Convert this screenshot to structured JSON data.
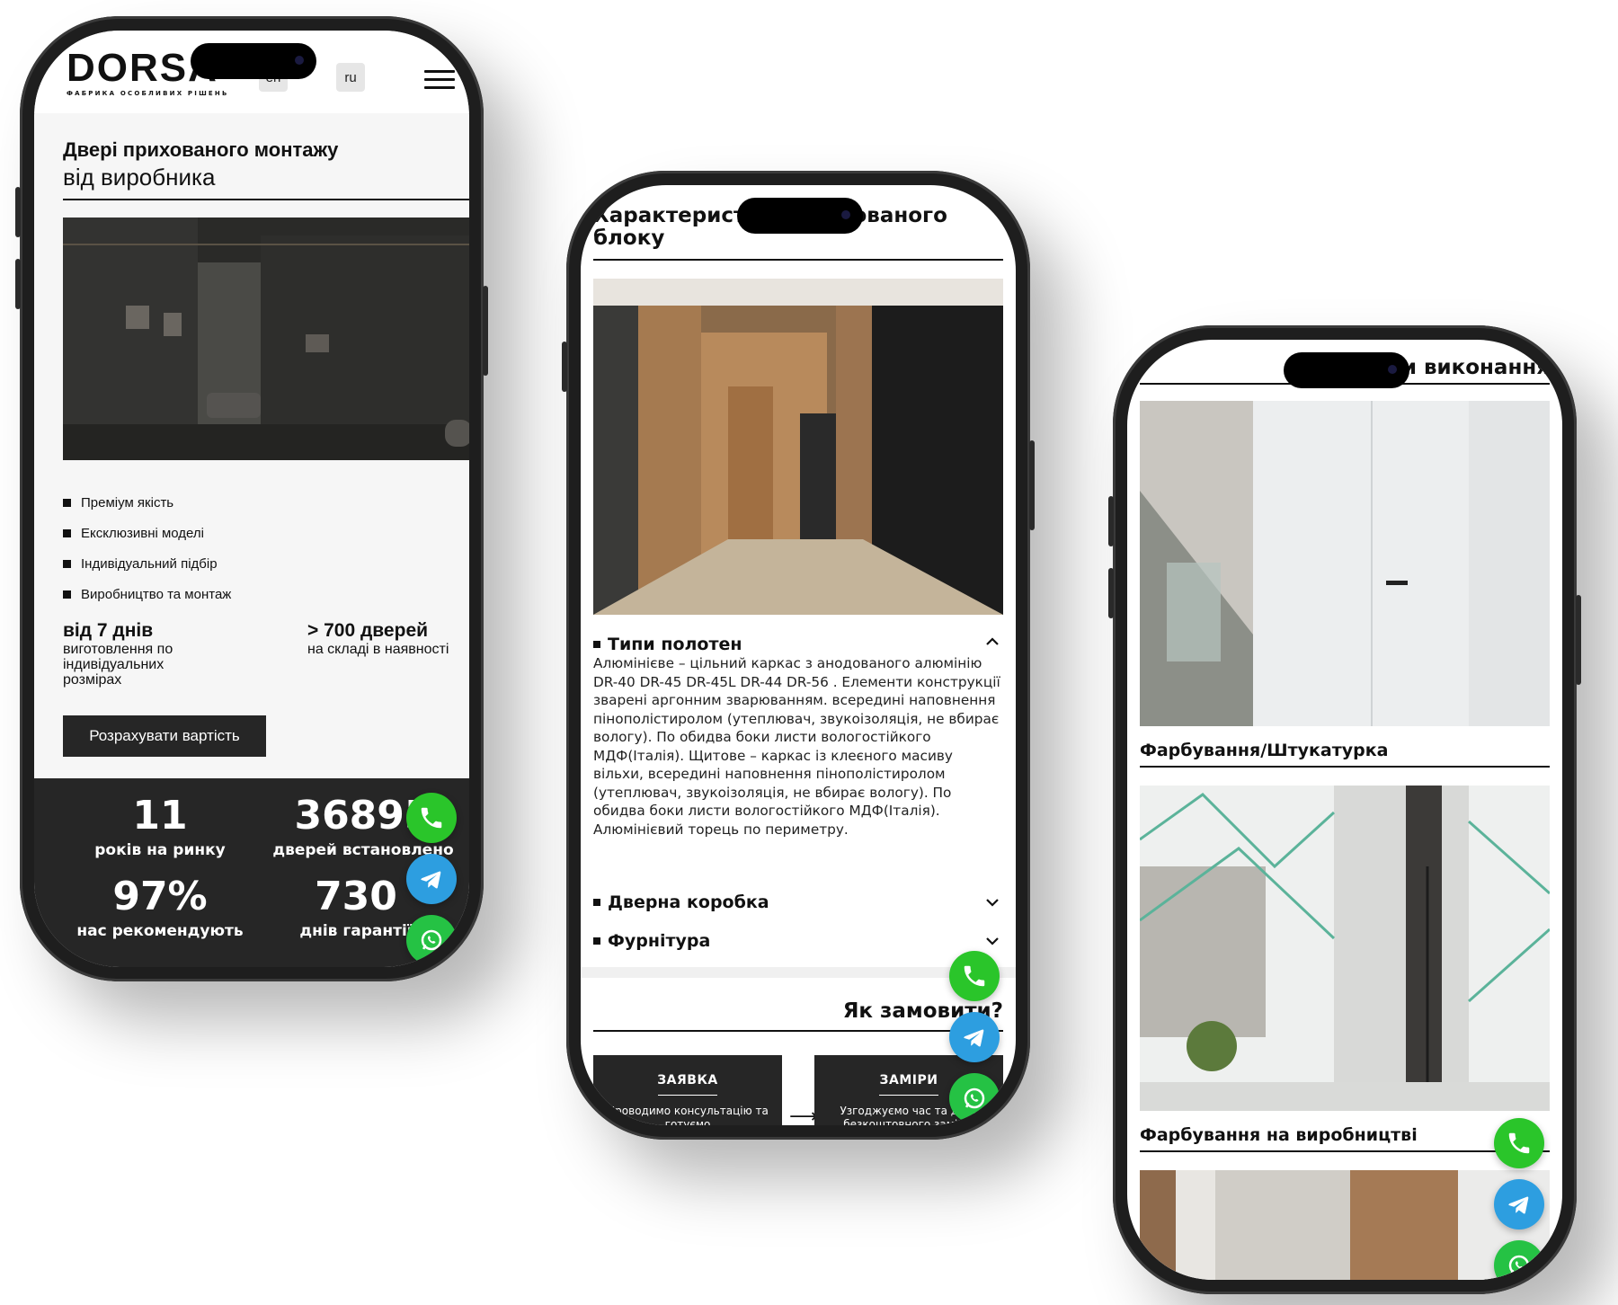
{
  "phone1": {
    "logo": "DORSA",
    "logo_sub": "ФАБРИКА ОСОБЛИВИХ РІШЕНЬ",
    "lang_en": "en",
    "lang_ru": "ru",
    "hero_title": "Двері прихованого монтажу",
    "hero_sub": "від виробника",
    "bullets": [
      "Преміум якість",
      "Ексклюзивні моделі",
      "Індивідуальний підбір",
      "Виробництво та монтаж"
    ],
    "feature_left_big": "від 7 днів",
    "feature_left_small": "виготовлення по індивідуальних розмірах",
    "feature_right_big": "> 700 дверей",
    "feature_right_small": "на складі в наявності",
    "cta": "Розрахувати вартість",
    "stats": [
      {
        "num": "11",
        "label": "років на ринку"
      },
      {
        "num": "36895",
        "label": "дверей встановлено"
      },
      {
        "num": "97%",
        "label": "нас рекомендують"
      },
      {
        "num": "730",
        "label": "днів гарантії"
      }
    ]
  },
  "phone2": {
    "title": "Характеристики прихованого блоку",
    "acc1": "Типи полотен",
    "acc1_text": "Алюмінієве – цільний каркас з анодованого алюмінію DR-40 DR-45 DR-45L DR-44 DR-56 . Елементи конструкції зварені аргонним зварюванням. всередині наповнення пінополістиролом (утеплювач, звукоізоляція, не вбирає вологу). По обидва боки листи вологостійкого МДФ(Італія). Щитове – каркас із клеєного масиву вільхи, всередині наповнення пінополістиролом (утеплювач, звукоізоляція, не вбирає вологу). По обидва боки листи вологостійкого МДФ(Італія). Алюмінієвий торець по периметру.",
    "acc2": "Дверна коробка",
    "acc3": "Фурнітура",
    "order_title": "Як замовити?",
    "step1_title": "ЗАЯВКА",
    "step1_desc": "Проводимо консультацію та готуємо",
    "step2_title": "ЗАМІРИ",
    "step2_desc": "Узгоджуємо час та дату безкоштовного заміру,",
    "arrow": "⟶"
  },
  "phone3": {
    "title": "Варіанти виконання",
    "caption1": "Фарбування/Штукатурка",
    "caption2": "Фарбування на виробництві"
  },
  "colors": {
    "dark": "#262626",
    "call": "#2ac52a",
    "telegram": "#2d9ee0",
    "whatsapp": "#25c244"
  },
  "icons": [
    "phone-icon",
    "telegram-icon",
    "whatsapp-icon",
    "hamburger-menu-icon",
    "chevron-up-icon",
    "chevron-down-icon"
  ]
}
